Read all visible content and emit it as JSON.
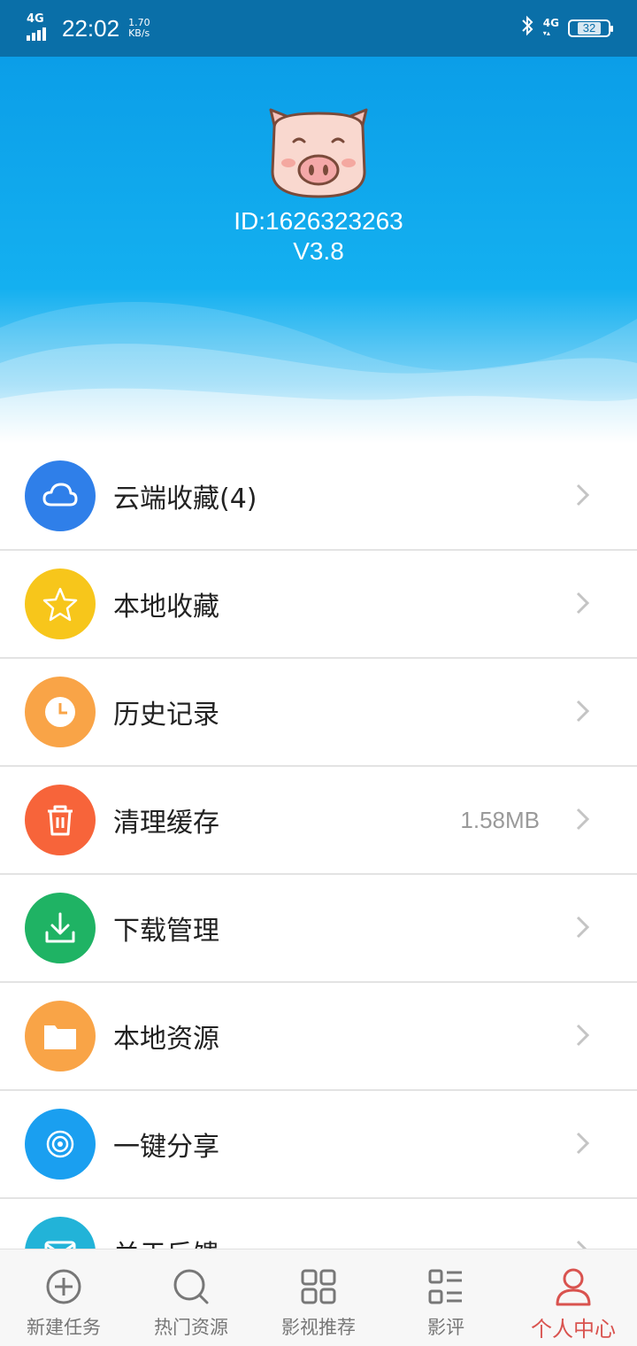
{
  "status_bar": {
    "network": "4G",
    "time": "22:02",
    "speed_value": "1.70",
    "speed_unit": "KB/s",
    "network_right": "4G",
    "battery": "32"
  },
  "profile": {
    "id": "ID:1626323263",
    "version": "V3.8"
  },
  "menu": {
    "items": [
      {
        "label": "云端收藏(4)",
        "color": "#2f7fe9",
        "icon": "cloud-icon",
        "value": ""
      },
      {
        "label": "本地收藏",
        "color": "#f7c61b",
        "icon": "star-icon",
        "value": ""
      },
      {
        "label": "历史记录",
        "color": "#f9a447",
        "icon": "clock-icon",
        "value": ""
      },
      {
        "label": "清理缓存",
        "color": "#f7643a",
        "icon": "trash-icon",
        "value": "1.58MB"
      },
      {
        "label": "下载管理",
        "color": "#1fb364",
        "icon": "download-icon",
        "value": ""
      },
      {
        "label": "本地资源",
        "color": "#f9a447",
        "icon": "folder-icon",
        "value": ""
      },
      {
        "label": "一键分享",
        "color": "#1a9ff0",
        "icon": "share-icon",
        "value": ""
      },
      {
        "label": "关于反馈",
        "color": "#22b3d8",
        "icon": "mail-icon",
        "value": ""
      }
    ]
  },
  "bottom_nav": {
    "items": [
      {
        "label": "新建任务",
        "icon": "plus-circle-icon"
      },
      {
        "label": "热门资源",
        "icon": "search-icon"
      },
      {
        "label": "影视推荐",
        "icon": "grid-icon"
      },
      {
        "label": "影评",
        "icon": "list-icon"
      },
      {
        "label": "个人中心",
        "icon": "user-icon"
      }
    ],
    "active_index": 4,
    "active_color": "#d9534f"
  }
}
